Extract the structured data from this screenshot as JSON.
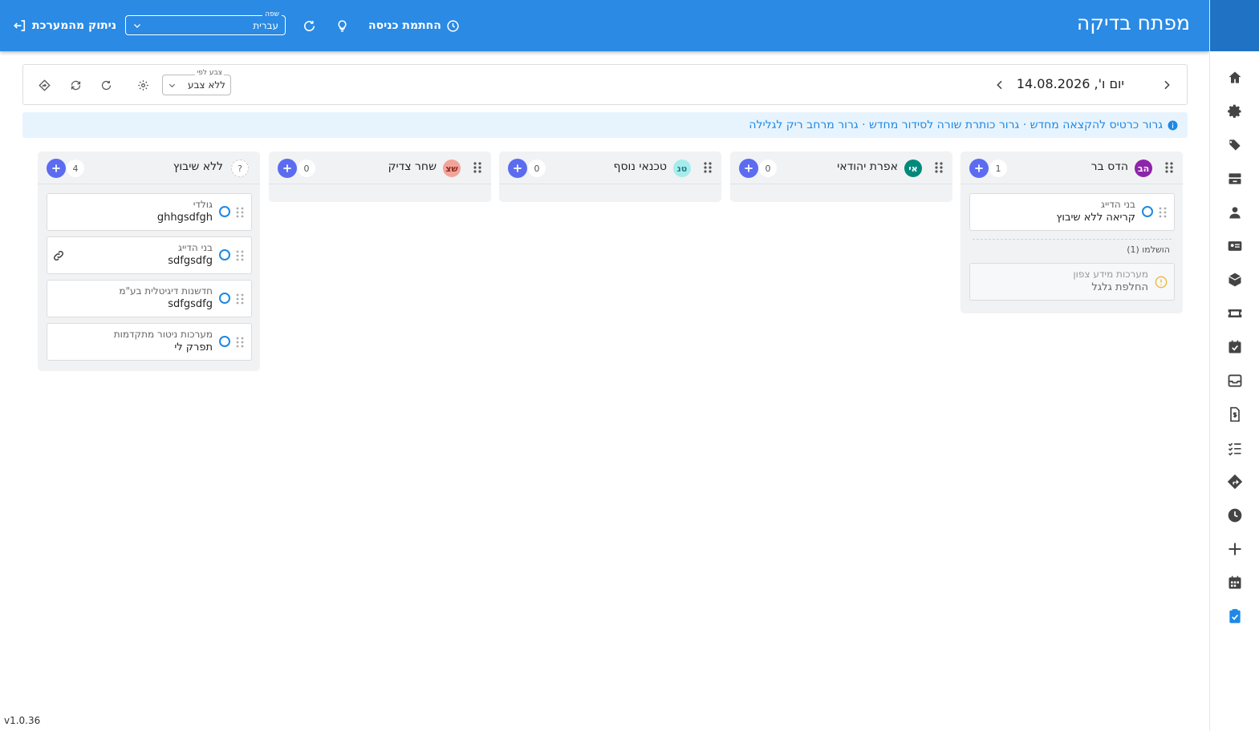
{
  "header": {
    "title": "מפתח בדיקה",
    "logout_label": "ניתוק מהמערכת",
    "clock_in_label": "החתמת כניסה",
    "language": {
      "label": "שפה",
      "value": "עברית"
    }
  },
  "toolbar": {
    "date": "יום ו', 14.08.2026",
    "color_by": {
      "label": "צבע לפי",
      "value": "ללא צבע"
    }
  },
  "info": {
    "text": "גרור כרטיס להקצאה מחדש · גרור כותרת שורה לסידור מחדש · גרור מרחב ריק לגלילה"
  },
  "columns": [
    {
      "initials": "הב",
      "name": "הדס בר",
      "count": "1",
      "avatar_color": "#8e24aa",
      "avatar_text_color": "#ffffff",
      "cards": [
        {
          "client": "בני הדייג",
          "title": "קריאה ללא שיבוץ"
        }
      ],
      "done_label": "הושלמו (1)",
      "done_cards": [
        {
          "client": "מערכות מידע צפון",
          "title": "החלפת גלגל"
        }
      ]
    },
    {
      "initials": "אי",
      "name": "אפרת יהודאי",
      "count": "0",
      "avatar_color": "#00897b",
      "avatar_text_color": "#ffffff",
      "cards": []
    },
    {
      "initials": "טנ",
      "name": "טכנאי נוסף",
      "count": "0",
      "avatar_color": "#a7ecec",
      "avatar_text_color": "#1b7f86",
      "cards": []
    },
    {
      "initials": "שצ",
      "name": "שחר צדיק",
      "count": "0",
      "avatar_color": "#f3a49a",
      "avatar_text_color": "#8c2a1c",
      "cards": []
    },
    {
      "initials": "?",
      "name": "ללא שיבוץ",
      "count": "4",
      "avatar_color": "#ffffff",
      "avatar_text_color": "#666666",
      "cards": [
        {
          "client": "גולדי",
          "title": "ghhgsdfgh"
        },
        {
          "client": "בני הדייג",
          "title": "sdfgsdfg",
          "linked": true
        },
        {
          "client": "חדשנות דיגיטלית בע\"מ",
          "title": "sdfgsdfg"
        },
        {
          "client": "מערכות ניטור מתקדמות",
          "title": "תפרק לי"
        }
      ]
    }
  ],
  "sidebar": {
    "icons": [
      "home-icon",
      "settings-icon",
      "tags-icon",
      "inventory-icon",
      "technician-icon",
      "contacts-icon",
      "box-icon",
      "ticket-icon",
      "task-check-icon",
      "inbox-icon",
      "invoice-icon",
      "checklist-icon",
      "directions-icon",
      "history-icon",
      "add-icon",
      "calendar-icon",
      "clipboard-check-icon"
    ],
    "active": "clipboard-check-icon"
  },
  "version": "v1.0.36",
  "colors": {
    "primary": "#2a8ae4",
    "accent": "#5b6cf0",
    "info_text": "#1e88e5"
  }
}
